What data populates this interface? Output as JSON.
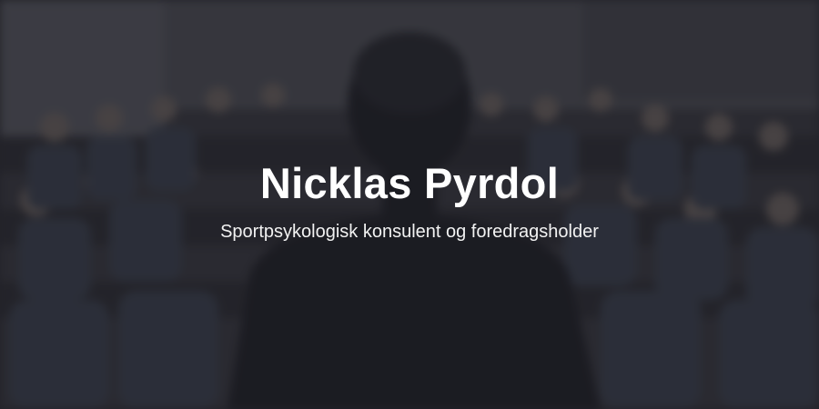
{
  "hero": {
    "title": "Nicklas Pyrdol",
    "subtitle": "Sportpsykologisk konsulent og foredragsholder",
    "background_image": "speaker-audience-photo",
    "overlay_color": "#1e1e24"
  }
}
